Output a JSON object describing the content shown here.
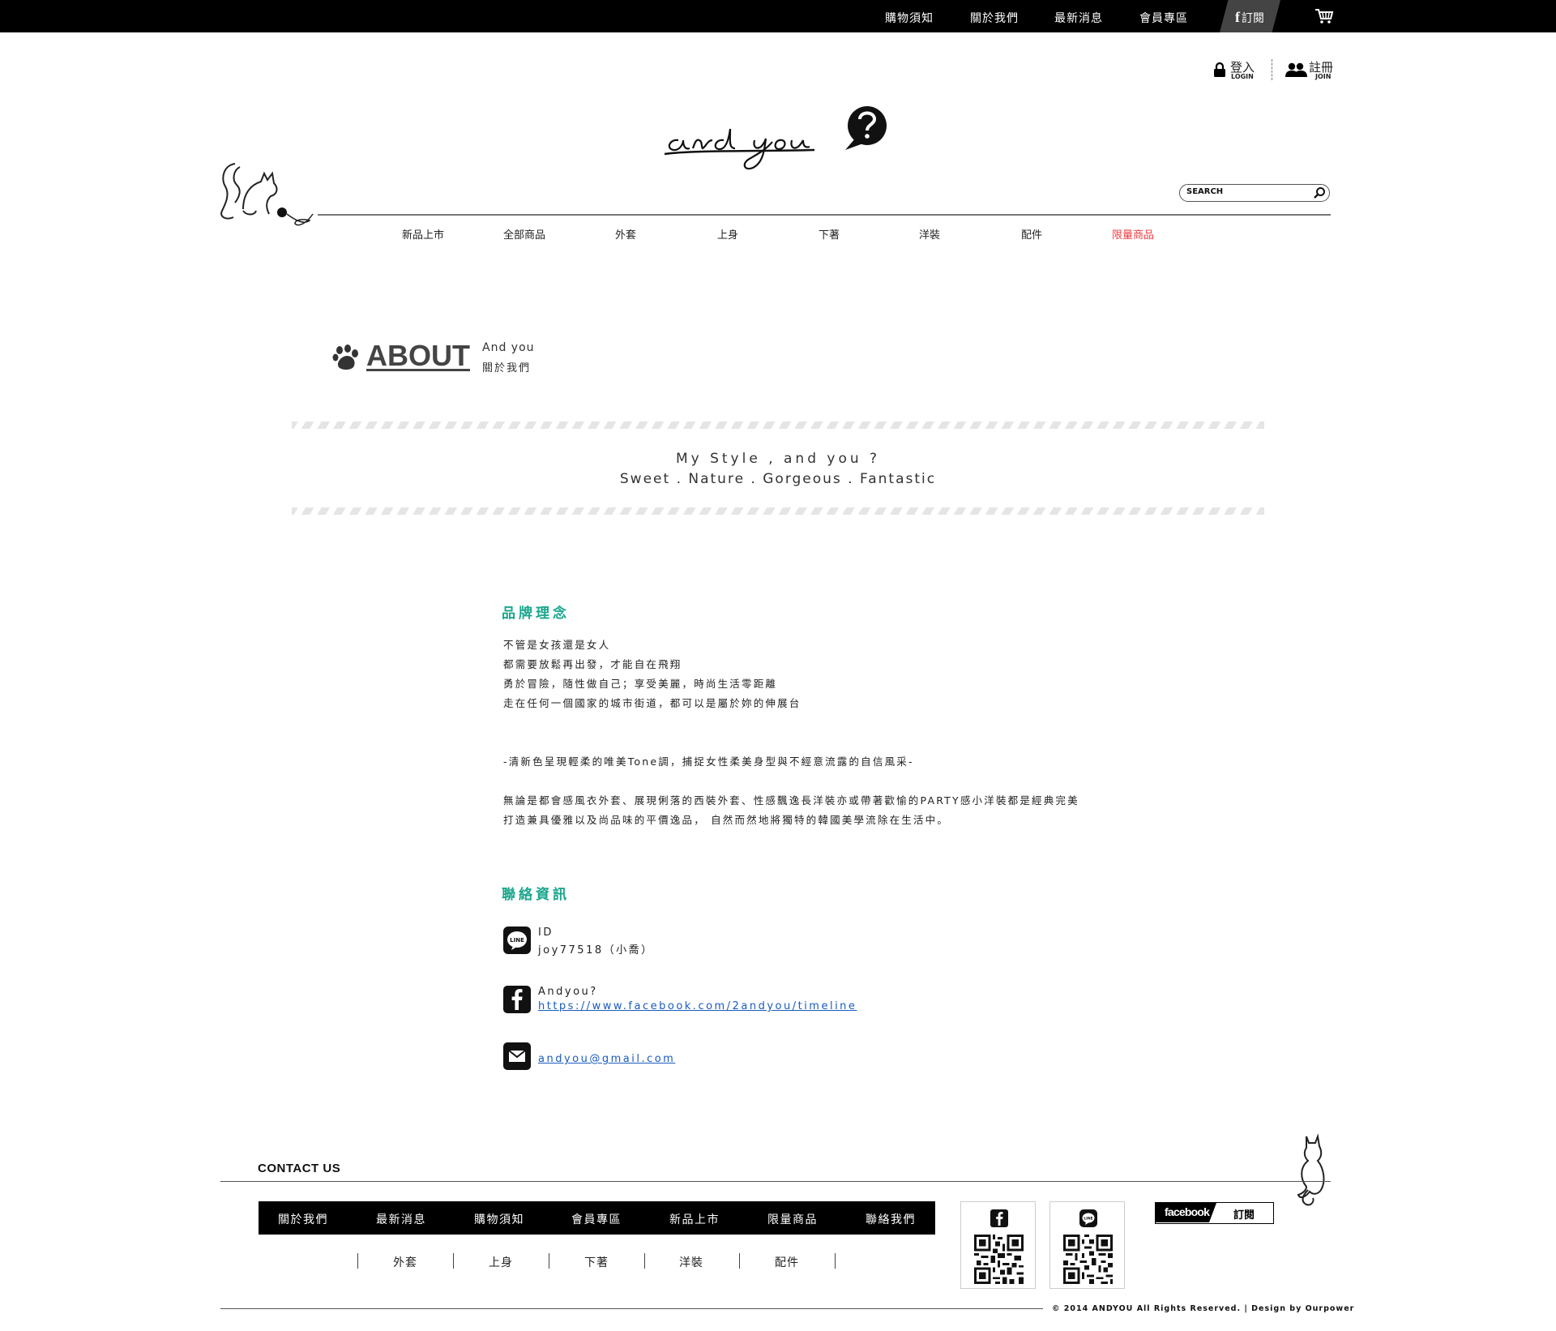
{
  "topbar": {
    "links": [
      "購物須知",
      "關於我們",
      "最新消息",
      "會員專區"
    ],
    "subscribe": {
      "icon": "f",
      "label": "訂閱"
    },
    "cart_icon": "cart-icon"
  },
  "account": {
    "login": {
      "label": "登入",
      "sub": "LOGIN"
    },
    "join": {
      "label": "註冊",
      "sub": "JOIN"
    }
  },
  "logo": {
    "text": "and you?"
  },
  "search": {
    "placeholder": "SEARCH"
  },
  "nav": {
    "items": [
      "新品上市",
      "全部商品",
      "外套",
      "上身",
      "下著",
      "洋裝",
      "配件",
      "限量商品"
    ],
    "highlight_color": "#ef3e42"
  },
  "about": {
    "title": "ABOUT",
    "subtitle_en": "And you",
    "subtitle_zh": "關於我們"
  },
  "slogan": {
    "line1": "My Style , and you ?",
    "line2": "Sweet . Nature . Gorgeous . Fantastic"
  },
  "brand": {
    "title": "品牌理念",
    "lines": [
      "不管是女孩還是女人",
      "都需要放鬆再出發，才能自在飛翔",
      "勇於冒險，隨性做自己；享受美麗，時尚生活零距離",
      "走在任何一個國家的城市街道，都可以是屬於妳的伸展台",
      "-清新色呈現輕柔的唯美Tone調，捕捉女性柔美身型與不經意流露的自信風采-",
      "無論是都會感風衣外套、展現俐落的西裝外套、性感飄逸長洋裝亦或帶著歡愉的PARTY感小洋裝都是經典完美",
      "打造兼具優雅以及尚品味的平價逸品， 自然而然地將獨特的韓國美學流除在生活中。"
    ],
    "accent_color": "#1aa68c"
  },
  "contact": {
    "title": "聯絡資訊",
    "line": {
      "label": "ID",
      "value": "joy77518（小喬）"
    },
    "facebook": {
      "name": "Andyou?",
      "url": "https://www.facebook.com/2andyou/timeline"
    },
    "email": "andyou@gmail.com"
  },
  "footer": {
    "contact_label": "CONTACT US",
    "nav": [
      "關於我們",
      "最新消息",
      "購物須知",
      "會員專區",
      "新品上市",
      "限量商品",
      "聯絡我們"
    ],
    "subnav": [
      "外套",
      "上身",
      "下著",
      "洋裝",
      "配件"
    ],
    "fb_button": {
      "word": "facebook",
      "label": "訂閱"
    },
    "copyright": "© 2014 ANDYOU All Rights Reserved. | Design by Ourpower"
  }
}
